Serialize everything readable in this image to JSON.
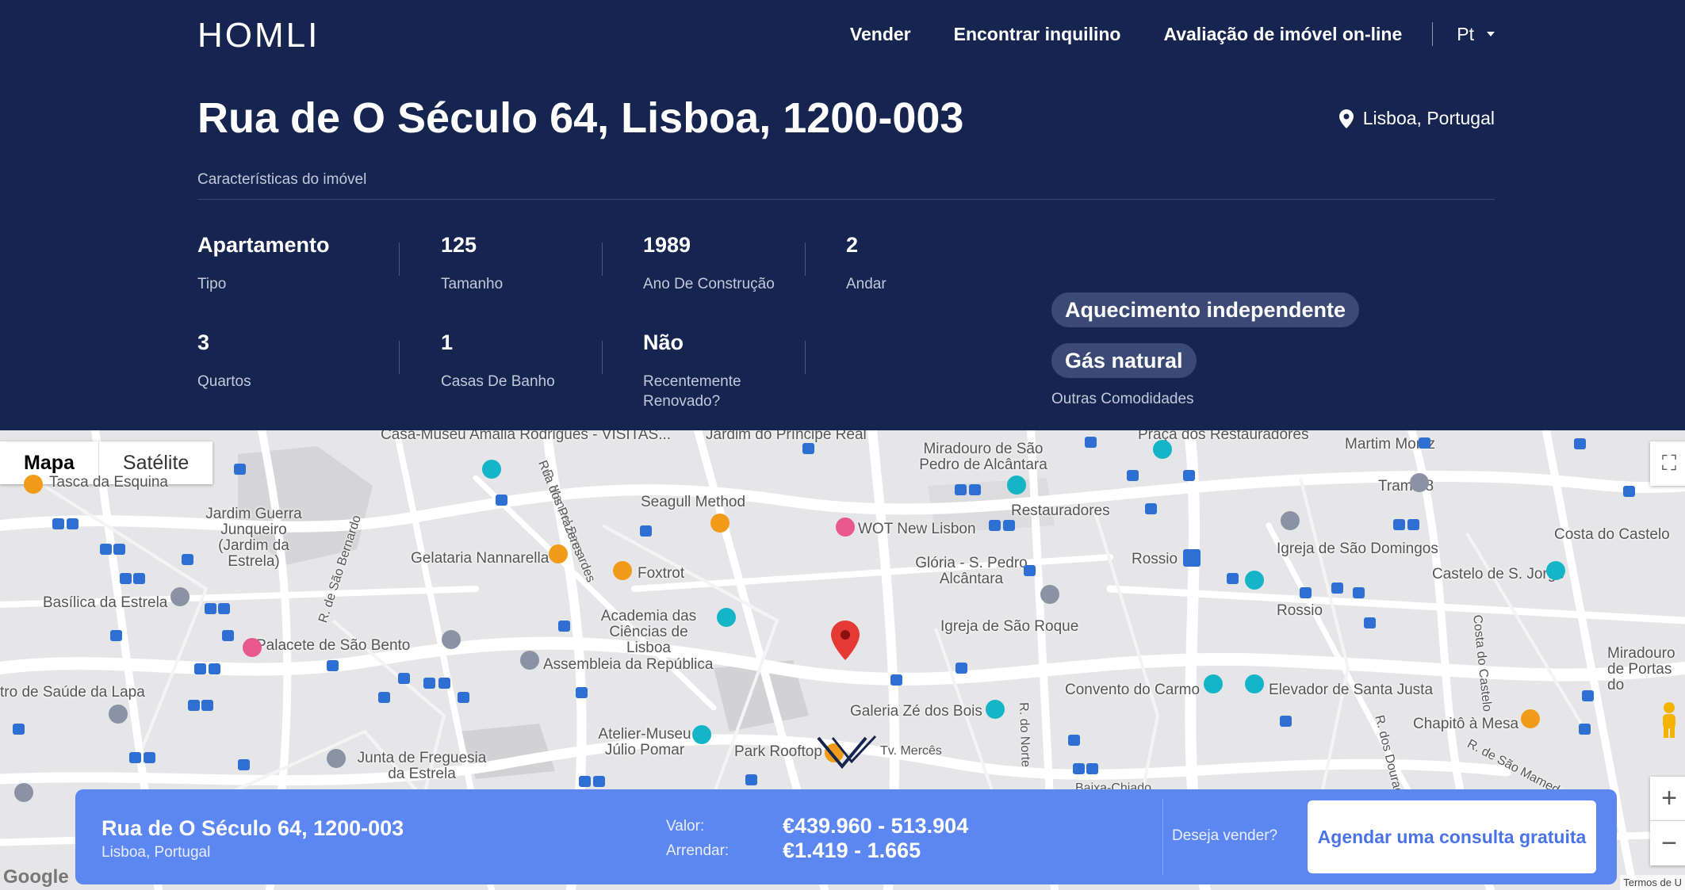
{
  "header": {
    "logo": "HOMLI",
    "nav": [
      "Vender",
      "Encontrar inquilino",
      "Avaliação de imóvel on-line"
    ],
    "language": "Pt"
  },
  "property": {
    "title": "Rua de O Século 64, Lisboa, 1200-003",
    "location": "Lisboa, Portugal",
    "section_label": "Características do imóvel",
    "features": [
      {
        "value": "Apartamento",
        "label": "Tipo"
      },
      {
        "value": "125",
        "label": "Tamanho"
      },
      {
        "value": "1989",
        "label": "Ano De Construção"
      },
      {
        "value": "2",
        "label": "Andar"
      },
      {
        "value": "3",
        "label": "Quartos"
      },
      {
        "value": "1",
        "label": "Casas De Banho"
      },
      {
        "value": "Não",
        "label": "Recentemente Renovado?"
      }
    ],
    "amenities": [
      "Aquecimento independente",
      "Gás natural"
    ],
    "amenities_label": "Outras Comodidades"
  },
  "map": {
    "type_options": [
      "Mapa",
      "Satélite"
    ],
    "labels": [
      "Casa-Museu Amália Rodrigues - VISITAS...",
      "Jardim do Príncipe Real",
      "Miradouro de São Pedro de Alcântara",
      "Praça dos Restauradores",
      "Martim Moniz",
      "Tasca da Esquina",
      "Jardim Guerra Junqueiro (Jardim da Estrela)",
      "Seagull Method",
      "WOT New Lisbon",
      "Restauradores",
      "Tram 28",
      "Costa do Castelo",
      "Gelataria Nannarella",
      "Foxtrot",
      "Glória - S. Pedro Alcântara",
      "Rossio",
      "Igreja de São Domingos",
      "Basílica da Estrela",
      "Academia das Ciências de Lisboa",
      "Castelo de S. Jorge",
      "Rossio",
      "Igreja de São Roque",
      "Palacete de São Bento",
      "Assembleia da República",
      "Miradouro de Portas do",
      "tro de Saúde da Lapa",
      "Convento do Carmo",
      "Elevador de Santa Justa",
      "Galeria Zé dos Bois",
      "Chapitô à Mesa",
      "Atelier-Museu Júlio Pomar",
      "Park Rooftop",
      "Tv. Mercês",
      "Junta de Freguesia da Estrela",
      "R. Manuel Bernardes",
      "Rua dos Prazeres",
      "R. de São Bernardo",
      "R. do Norte",
      "Costa do Castelo",
      "R. dos Douradores",
      "R. de São Mamede",
      "Baixa-Chiado"
    ],
    "google": "Google",
    "terms": "Termos de U"
  },
  "card": {
    "address": "Rua de O Século 64, 1200-003",
    "city": "Lisboa, Portugal",
    "value_label": "Valor:",
    "value": "€439.960 - 513.904",
    "rent_label": "Arrendar:",
    "rent": "€1.419 - 1.665",
    "ask": "Deseja vender?",
    "cta": "Agendar uma consulta gratuita"
  }
}
